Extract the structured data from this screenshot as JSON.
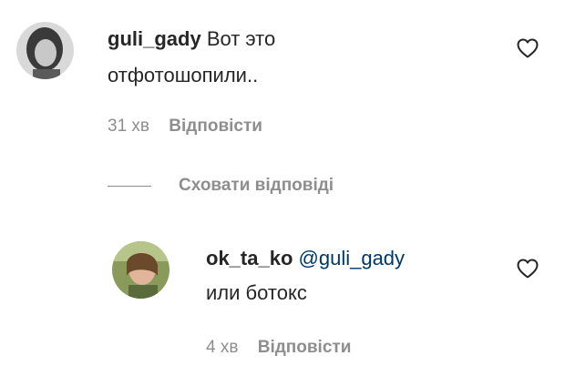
{
  "comment": {
    "username": "guli_gady",
    "text_line1": "Вот это",
    "text_line2": "отфотошопили..",
    "time": "31 хв",
    "reply_label": "Відповісти"
  },
  "hide_replies_label": "Сховати відповіді",
  "reply": {
    "username": "ok_ta_ko",
    "mention": "@guli_gady",
    "text": "или ботокс",
    "time": "4 хв",
    "reply_label": "Відповісти"
  },
  "icons": {
    "like": "heart-outline-icon"
  }
}
